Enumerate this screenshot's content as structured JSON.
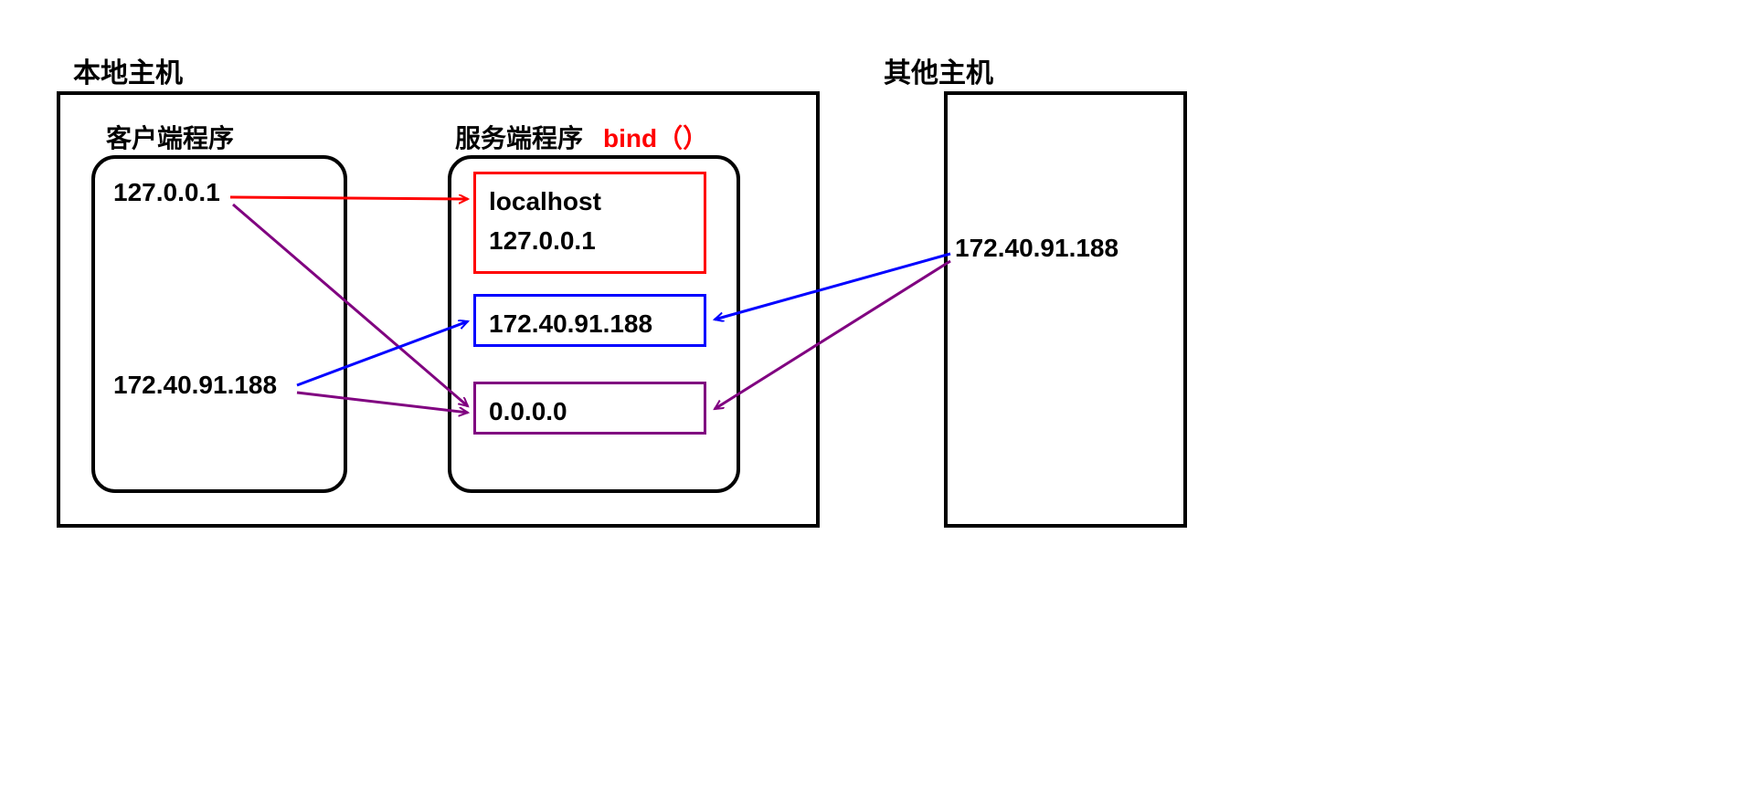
{
  "titles": {
    "local_host": "本地主机",
    "other_host": "其他主机"
  },
  "local": {
    "client": {
      "title": "客户端程序",
      "ip_loopback": "127.0.0.1",
      "ip_lan": "172.40.91.188"
    },
    "server": {
      "title": "服务端程序",
      "bind_label": "bind（）",
      "bind_localhost_line1": "localhost",
      "bind_localhost_line2": "127.0.0.1",
      "bind_lan": "172.40.91.188",
      "bind_any": "0.0.0.0"
    }
  },
  "other": {
    "ip": "172.40.91.188"
  },
  "colors": {
    "red": "#ff0000",
    "blue": "#0000ff",
    "purple": "#800080",
    "black": "#000000"
  }
}
